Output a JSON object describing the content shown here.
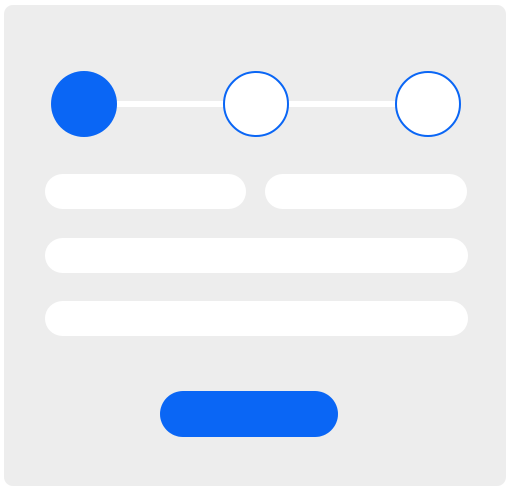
{
  "stepper": {
    "current_step": 1,
    "total_steps": 3,
    "steps": [
      {
        "state": "active"
      },
      {
        "state": "pending"
      },
      {
        "state": "pending"
      }
    ]
  },
  "form": {
    "fields": [
      {
        "value": "",
        "placeholder": ""
      },
      {
        "value": "",
        "placeholder": ""
      },
      {
        "value": "",
        "placeholder": ""
      },
      {
        "value": "",
        "placeholder": ""
      }
    ],
    "submit_label": ""
  },
  "colors": {
    "accent": "#0a66f5",
    "card_background": "#ededed",
    "field_background": "#ffffff"
  }
}
